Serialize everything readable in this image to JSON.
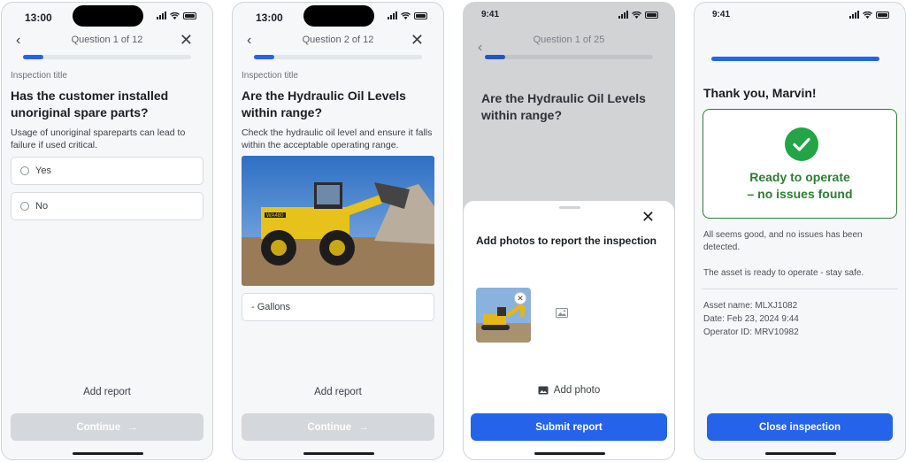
{
  "screens": [
    {
      "time": "13:00",
      "header": {
        "back_icon": "chevron-left-icon",
        "title": "Question 1 of 12",
        "close_icon": "close-icon"
      },
      "progress": 0.12,
      "label": "Inspection title",
      "heading": "Has the customer installed unoriginal spare parts?",
      "description": "Usage of unoriginal spareparts can lead to failure if used critical.",
      "options": [
        "Yes",
        "No"
      ],
      "add_report": "Add report",
      "continue_label": "Continue"
    },
    {
      "time": "13:00",
      "header": {
        "title": "Question 2 of 12"
      },
      "progress": 0.12,
      "label": "Inspection title",
      "heading": "Are the Hydraulic Oil Levels within range?",
      "description": "Check the hydraulic oil level and ensure it falls within the acceptable operating range.",
      "image_caption": "WA480",
      "input_value": "-  Gallons",
      "add_report": "Add report",
      "continue_label": "Continue"
    },
    {
      "time": "9:41",
      "header": {
        "title": "Question 1 of 25"
      },
      "progress": 0.12,
      "heading": "Are the Hydraulic Oil Levels within range?",
      "sheet": {
        "title": "Add photos to report the inspection",
        "add_photo": "Add photo",
        "submit": "Submit report"
      }
    },
    {
      "time": "9:41",
      "progress": 1.0,
      "thanks": "Thank you, Marvin!",
      "status_line1": "Ready to operate",
      "status_line2": "– no issues found",
      "msg1": "All seems good, and no issues has been detected.",
      "msg2": "The asset is ready to operate - stay safe.",
      "asset": "Asset name: MLXJ1082",
      "date": "Date: Feb 23, 2024 9:44",
      "operator": "Operator ID: MRV10982",
      "close_button": "Close inspection"
    }
  ],
  "colors": {
    "primary": "#2563eb",
    "success": "#2e7d32",
    "disabled": "#d4d7db"
  }
}
